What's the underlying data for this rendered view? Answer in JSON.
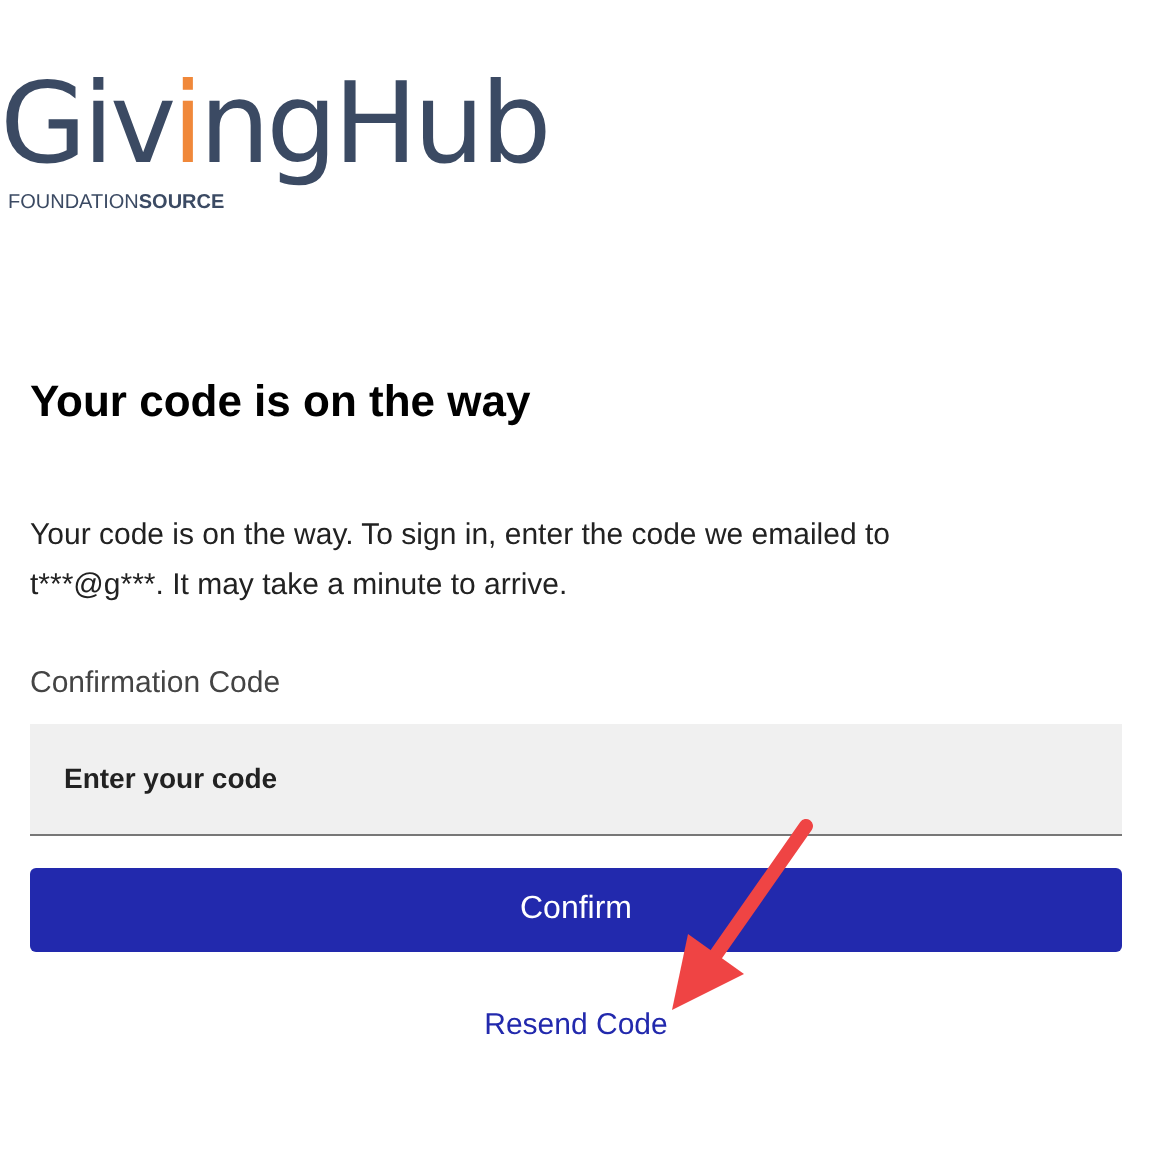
{
  "logo": {
    "wordmark": [
      {
        "text": "Giv",
        "accent": false
      },
      {
        "text": "i",
        "accent": true
      },
      {
        "text": "ngHub",
        "accent": false
      }
    ],
    "tagline": "FOUNDATION**SOURCE**"
  },
  "heading": "Your code is on the way",
  "message": "Your code is on the way. To sign in, enter the code we emailed to t***@g***. It may take a minute to arrive.",
  "field": {
    "label": "Confirmation Code",
    "placeholder": "Enter your code"
  },
  "confirm_button": "Confirm",
  "resend_link": "Resend Code"
}
